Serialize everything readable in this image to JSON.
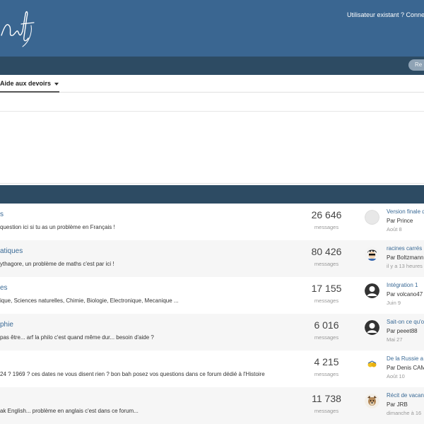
{
  "header": {
    "user_links": "Utilisateur existant ? Connexion"
  },
  "search": {
    "label": "Re"
  },
  "tabs": {
    "active_label": "Aide aux devoirs"
  },
  "forums": [
    {
      "title": "s",
      "description": "question ici si tu as un problème en Français !",
      "count": "26 646",
      "count_label": "messages",
      "last_title": "Version finale d",
      "last_author": "Par Prince",
      "last_date": "Août 8",
      "avatar": "default-avatar"
    },
    {
      "title": "atiques",
      "description": "ythagore, un problème de maths c'est par ici !",
      "count": "80 426",
      "count_label": "messages",
      "last_title": "racines carrés",
      "last_author": "Par Boltzmann",
      "last_date": "il y a 13 heures",
      "avatar": "cartoon-avatar"
    },
    {
      "title": "es",
      "description": "ique, Sciences naturelles, Chimie, Biologie, Electronique, Mecanique ...",
      "count": "17 155",
      "count_label": "messages",
      "last_title": "Intégration 1",
      "last_author": "Par volcano47",
      "last_date": "Juin 9",
      "avatar": "silhouette-avatar"
    },
    {
      "title": "phie",
      "description": "pas être... arf la philo c'est quand même dur... besoin d'aide ?",
      "count": "6 016",
      "count_label": "messages",
      "last_title": "Sait-on ce qu'o",
      "last_author": "Par peeet88",
      "last_date": "Mai 27",
      "avatar": "silhouette-avatar"
    },
    {
      "title": "",
      "description": "24 ? 1969 ? ces dates ne vous disent rien ? bon bah posez vos questions dans ce forum dédié à l'Histoire",
      "count": "4 215",
      "count_label": "messages",
      "last_title": "De la Russie a",
      "last_author": "Par Denis CAM",
      "last_date": "Août 10",
      "avatar": "cartoon-avatar"
    },
    {
      "title": "",
      "description": "ak English... problème en anglais c'est dans ce forum...",
      "count": "11 738",
      "count_label": "messages",
      "last_title": "Récit de vacan",
      "last_author": "Par JRB",
      "last_date": "dimanche à 16",
      "avatar": "dog-avatar"
    }
  ]
}
